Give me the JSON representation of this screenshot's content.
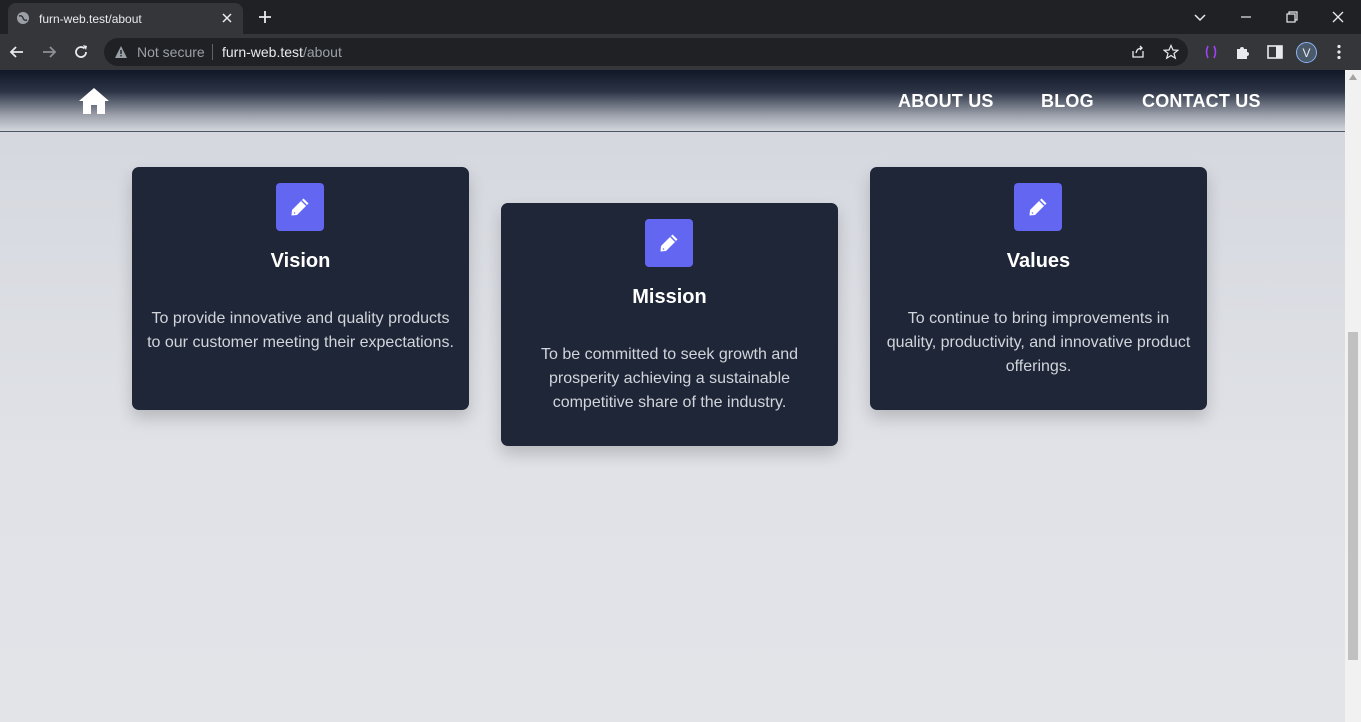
{
  "browser": {
    "tab_title": "furn-web.test/about",
    "security_label": "Not secure",
    "url_host": "furn-web.test",
    "url_path": "/about",
    "profile_initial": "V"
  },
  "header": {
    "nav": [
      "ABOUT US",
      "BLOG",
      "CONTACT US"
    ]
  },
  "cards": [
    {
      "title": "Vision",
      "text": "To provide innovative and quality products to our customer meeting their expectations.",
      "icon": "pencil-icon"
    },
    {
      "title": "Mission",
      "text": "To be committed to seek growth and prosperity achieving a sustainable competitive share of the industry.",
      "icon": "pencil-icon"
    },
    {
      "title": "Values",
      "text": "To continue to bring improvements in quality, productivity, and innovative product offerings.",
      "icon": "pencil-icon"
    }
  ],
  "colors": {
    "card_bg": "#1f2637",
    "icon_accent": "#6366f1"
  }
}
